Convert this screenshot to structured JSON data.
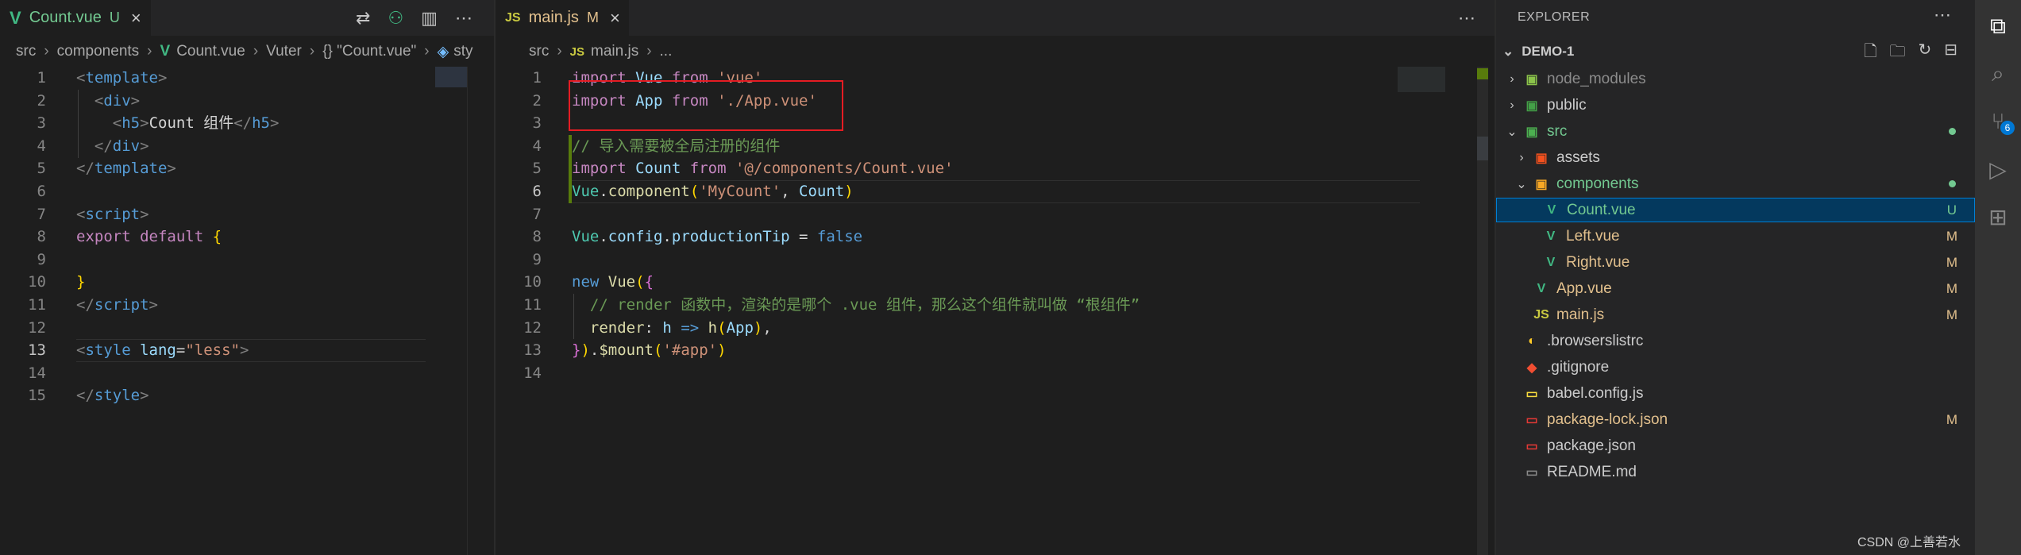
{
  "left_editor": {
    "tab": {
      "file": "Count.vue",
      "status": "U",
      "close": "×"
    },
    "actions": [
      "⇄",
      "⚇",
      "▥",
      "⋯"
    ],
    "breadcrumb": [
      "src",
      "components",
      "Count.vue",
      "Vuter",
      "{} \"Count.vue\"",
      "sty"
    ],
    "lines": [
      {
        "n": "1",
        "t": [
          [
            "t-tag",
            "<"
          ],
          [
            "t-name",
            "template"
          ],
          [
            "t-tag",
            ">"
          ]
        ]
      },
      {
        "n": "2",
        "t": [
          [
            "t-pl",
            "  "
          ],
          [
            "t-tag",
            "<"
          ],
          [
            "t-name",
            "div"
          ],
          [
            "t-tag",
            ">"
          ]
        ]
      },
      {
        "n": "3",
        "t": [
          [
            "t-pl",
            "    "
          ],
          [
            "t-tag",
            "<"
          ],
          [
            "t-name",
            "h5"
          ],
          [
            "t-tag",
            ">"
          ],
          [
            "t-pl",
            "Count 组件"
          ],
          [
            "t-tag",
            "</"
          ],
          [
            "t-name",
            "h5"
          ],
          [
            "t-tag",
            ">"
          ]
        ]
      },
      {
        "n": "4",
        "t": [
          [
            "t-pl",
            "  "
          ],
          [
            "t-tag",
            "</"
          ],
          [
            "t-name",
            "div"
          ],
          [
            "t-tag",
            ">"
          ]
        ]
      },
      {
        "n": "5",
        "t": [
          [
            "t-tag",
            "</"
          ],
          [
            "t-name",
            "template"
          ],
          [
            "t-tag",
            ">"
          ]
        ]
      },
      {
        "n": "6",
        "t": []
      },
      {
        "n": "7",
        "t": [
          [
            "t-tag",
            "<"
          ],
          [
            "t-name",
            "script"
          ],
          [
            "t-tag",
            ">"
          ]
        ]
      },
      {
        "n": "8",
        "t": [
          [
            "t-kw",
            "export"
          ],
          [
            "t-pl",
            " "
          ],
          [
            "t-kw",
            "default"
          ],
          [
            "t-pl",
            " "
          ],
          [
            "t-br",
            "{"
          ]
        ]
      },
      {
        "n": "9",
        "t": []
      },
      {
        "n": "10",
        "t": [
          [
            "t-br",
            "}"
          ]
        ]
      },
      {
        "n": "11",
        "t": [
          [
            "t-tag",
            "</"
          ],
          [
            "t-name",
            "script"
          ],
          [
            "t-tag",
            ">"
          ]
        ]
      },
      {
        "n": "12",
        "t": []
      },
      {
        "n": "13",
        "t": [
          [
            "t-tag",
            "<"
          ],
          [
            "t-name",
            "style"
          ],
          [
            "t-pl",
            " "
          ],
          [
            "t-attr",
            "lang"
          ],
          [
            "t-pl",
            "="
          ],
          [
            "t-str",
            "\"less\""
          ],
          [
            "t-tag",
            ">"
          ]
        ]
      },
      {
        "n": "14",
        "t": []
      },
      {
        "n": "15",
        "t": [
          [
            "t-tag",
            "</"
          ],
          [
            "t-name",
            "style"
          ],
          [
            "t-tag",
            ">"
          ]
        ]
      }
    ]
  },
  "main_editor": {
    "tab": {
      "file": "main.js",
      "status": "M",
      "close": "×",
      "icon": "JS"
    },
    "more": "⋯",
    "breadcrumb": [
      "src",
      "main.js",
      "..."
    ],
    "lines": [
      {
        "n": "1",
        "t": [
          [
            "t-kw",
            "import"
          ],
          [
            "t-pl",
            " "
          ],
          [
            "t-var",
            "Vue"
          ],
          [
            "t-pl",
            " "
          ],
          [
            "t-kw",
            "from"
          ],
          [
            "t-pl",
            " "
          ],
          [
            "t-str",
            "'vue'"
          ]
        ]
      },
      {
        "n": "2",
        "t": [
          [
            "t-kw",
            "import"
          ],
          [
            "t-pl",
            " "
          ],
          [
            "t-var",
            "App"
          ],
          [
            "t-pl",
            " "
          ],
          [
            "t-kw",
            "from"
          ],
          [
            "t-pl",
            " "
          ],
          [
            "t-str",
            "'./App.vue'"
          ]
        ]
      },
      {
        "n": "3",
        "t": []
      },
      {
        "n": "4",
        "t": [
          [
            "t-com",
            "// 导入需要被全局注册的组件"
          ]
        ]
      },
      {
        "n": "5",
        "t": [
          [
            "t-kw",
            "import"
          ],
          [
            "t-pl",
            " "
          ],
          [
            "t-var",
            "Count"
          ],
          [
            "t-pl",
            " "
          ],
          [
            "t-kw",
            "from"
          ],
          [
            "t-pl",
            " "
          ],
          [
            "t-str",
            "'@/components/Count.vue'"
          ]
        ]
      },
      {
        "n": "6",
        "t": [
          [
            "t-cls",
            "Vue"
          ],
          [
            "t-pl",
            "."
          ],
          [
            "t-fn",
            "component"
          ],
          [
            "t-br",
            "("
          ],
          [
            "t-str",
            "'MyCount'"
          ],
          [
            "t-pl",
            ", "
          ],
          [
            "t-var",
            "Count"
          ],
          [
            "t-br",
            ")"
          ]
        ]
      },
      {
        "n": "7",
        "t": []
      },
      {
        "n": "8",
        "t": [
          [
            "t-cls",
            "Vue"
          ],
          [
            "t-pl",
            "."
          ],
          [
            "t-var",
            "config"
          ],
          [
            "t-pl",
            "."
          ],
          [
            "t-var",
            "productionTip"
          ],
          [
            "t-pl",
            " = "
          ],
          [
            "t-kw2",
            "false"
          ]
        ]
      },
      {
        "n": "9",
        "t": []
      },
      {
        "n": "10",
        "t": [
          [
            "t-kw2",
            "new"
          ],
          [
            "t-pl",
            " "
          ],
          [
            "t-fn",
            "Vue"
          ],
          [
            "t-br",
            "("
          ],
          [
            "t-br2",
            "{"
          ]
        ]
      },
      {
        "n": "11",
        "t": [
          [
            "t-pl",
            "  "
          ],
          [
            "t-com",
            "// render 函数中，渲染的是哪个 .vue 组件，那么这个组件就叫做 “根组件”"
          ]
        ]
      },
      {
        "n": "12",
        "t": [
          [
            "t-pl",
            "  "
          ],
          [
            "t-fn",
            "render"
          ],
          [
            "t-pl",
            ": "
          ],
          [
            "t-var",
            "h"
          ],
          [
            "t-pl",
            " "
          ],
          [
            "t-kw2",
            "=>"
          ],
          [
            "t-pl",
            " "
          ],
          [
            "t-fn",
            "h"
          ],
          [
            "t-br",
            "("
          ],
          [
            "t-var",
            "App"
          ],
          [
            "t-br",
            ")"
          ],
          [
            "t-pl",
            ","
          ]
        ]
      },
      {
        "n": "13",
        "t": [
          [
            "t-br2",
            "}"
          ],
          [
            "t-br",
            ")"
          ],
          [
            "t-pl",
            "."
          ],
          [
            "t-fn",
            "$mount"
          ],
          [
            "t-br",
            "("
          ],
          [
            "t-str",
            "'#app'"
          ],
          [
            "t-br",
            ")"
          ]
        ]
      },
      {
        "n": "14",
        "t": []
      }
    ]
  },
  "explorer": {
    "title": "EXPLORER",
    "more": "⋯",
    "project": "DEMO-1",
    "project_actions": [
      "🗋",
      "🗀",
      "↻",
      "⊟"
    ],
    "items": [
      {
        "label": "node_modules",
        "chev": "›",
        "icon": "▣",
        "icon_class": "ico-node",
        "color": "col-dim",
        "depth": 1,
        "badge": "",
        "dot": ""
      },
      {
        "label": "public",
        "chev": "›",
        "icon": "▣",
        "icon_class": "ico-public",
        "color": "",
        "depth": 1,
        "badge": "",
        "dot": ""
      },
      {
        "label": "src",
        "chev": "⌄",
        "icon": "▣",
        "icon_class": "ico-src",
        "color": "col-green",
        "depth": 1,
        "badge": "",
        "dot": "#73c991"
      },
      {
        "label": "assets",
        "chev": "›",
        "icon": "▣",
        "icon_class": "ico-assets",
        "color": "",
        "depth": 2,
        "badge": "",
        "dot": ""
      },
      {
        "label": "components",
        "chev": "⌄",
        "icon": "▣",
        "icon_class": "ico-comp",
        "color": "col-green",
        "depth": 2,
        "badge": "",
        "dot": "#73c991"
      },
      {
        "label": "Count.vue",
        "chev": "",
        "icon": "V",
        "icon_class": "ico-vue",
        "color": "col-green",
        "depth": 3,
        "badge": "U",
        "badge_color": "#73c991",
        "selected": true
      },
      {
        "label": "Left.vue",
        "chev": "",
        "icon": "V",
        "icon_class": "ico-vue",
        "color": "col-mod",
        "depth": 3,
        "badge": "M",
        "badge_color": "#e2c08d"
      },
      {
        "label": "Right.vue",
        "chev": "",
        "icon": "V",
        "icon_class": "ico-vue",
        "color": "col-mod",
        "depth": 3,
        "badge": "M",
        "badge_color": "#e2c08d"
      },
      {
        "label": "App.vue",
        "chev": "",
        "icon": "V",
        "icon_class": "ico-vue",
        "color": "col-mod",
        "depth": 2,
        "badge": "M",
        "badge_color": "#e2c08d"
      },
      {
        "label": "main.js",
        "chev": "",
        "icon": "JS",
        "icon_class": "ico-js",
        "color": "col-mod",
        "depth": 2,
        "badge": "M",
        "badge_color": "#e2c08d"
      },
      {
        "label": ".browserslistrc",
        "chev": "",
        "icon": "◐",
        "icon_class": "ico-bl",
        "color": "",
        "depth": 1,
        "badge": ""
      },
      {
        "label": ".gitignore",
        "chev": "",
        "icon": "◆",
        "icon_class": "ico-git",
        "color": "",
        "depth": 1,
        "badge": ""
      },
      {
        "label": "babel.config.js",
        "chev": "",
        "icon": "▭",
        "icon_class": "ico-babel",
        "color": "",
        "depth": 1,
        "badge": ""
      },
      {
        "label": "package-lock.json",
        "chev": "",
        "icon": "▭",
        "icon_class": "ico-json",
        "color": "col-mod",
        "depth": 1,
        "badge": "M",
        "badge_color": "#e2c08d"
      },
      {
        "label": "package.json",
        "chev": "",
        "icon": "▭",
        "icon_class": "ico-json",
        "color": "",
        "depth": 1,
        "badge": ""
      },
      {
        "label": "README.md",
        "chev": "",
        "icon": "▭",
        "icon_class": "ico-md",
        "color": "",
        "depth": 1,
        "badge": ""
      }
    ],
    "watermark": "CSDN @上善若水"
  },
  "activity_bar": {
    "items": [
      {
        "name": "explorer-icon",
        "glyph": "⧉",
        "active": true
      },
      {
        "name": "search-icon",
        "glyph": "⌕",
        "active": false
      },
      {
        "name": "source-control-icon",
        "glyph": "⑂",
        "active": false,
        "badge": "6"
      },
      {
        "name": "run-debug-icon",
        "glyph": "▷",
        "active": false
      },
      {
        "name": "extensions-icon",
        "glyph": "⊞",
        "active": false
      }
    ]
  }
}
